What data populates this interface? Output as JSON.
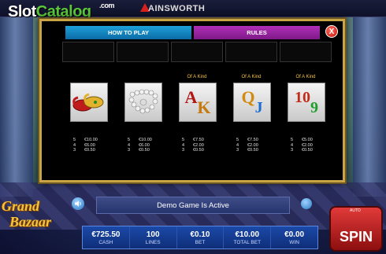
{
  "watermark": {
    "slot": "Slot",
    "catalog": "Catalog",
    "com": ".com"
  },
  "brand": "AINSWORTH",
  "tabs": {
    "how_to_play": "HOW TO PLAY",
    "rules": "RULES"
  },
  "close_label": "X",
  "symbols": [
    {
      "name": "slippers",
      "of_a_kind": "",
      "pays": [
        [
          "5",
          "€10.00"
        ],
        [
          "4",
          "€6.00"
        ],
        [
          "3",
          "€0.50"
        ]
      ]
    },
    {
      "name": "pearls",
      "of_a_kind": "",
      "pays": [
        [
          "5",
          "€10.00"
        ],
        [
          "4",
          "€6.00"
        ],
        [
          "3",
          "€0.50"
        ]
      ]
    },
    {
      "name": "AK",
      "of_a_kind": "Of A Kind",
      "pays": [
        [
          "5",
          "€7.50"
        ],
        [
          "4",
          "€2.00"
        ],
        [
          "3",
          "€0.50"
        ]
      ]
    },
    {
      "name": "QJ",
      "of_a_kind": "Of A Kind",
      "pays": [
        [
          "5",
          "€7.50"
        ],
        [
          "4",
          "€2.00"
        ],
        [
          "3",
          "€0.50"
        ]
      ]
    },
    {
      "name": "109",
      "of_a_kind": "Of A Kind",
      "pays": [
        [
          "5",
          "€5.00"
        ],
        [
          "4",
          "€2.00"
        ],
        [
          "3",
          "€0.50"
        ]
      ]
    }
  ],
  "logo": {
    "line1": "Grand",
    "line2": "Bazaar"
  },
  "demo_text": "Demo Game Is Active",
  "stats": [
    {
      "value": "€725.50",
      "label": "CASH"
    },
    {
      "value": "100",
      "label": "LINES"
    },
    {
      "value": "€0.10",
      "label": "BET"
    },
    {
      "value": "€10.00",
      "label": "TOTAL BET"
    },
    {
      "value": "€0.00",
      "label": "WIN"
    }
  ],
  "spin_label": "SPIN",
  "auto_label": "AUTO"
}
